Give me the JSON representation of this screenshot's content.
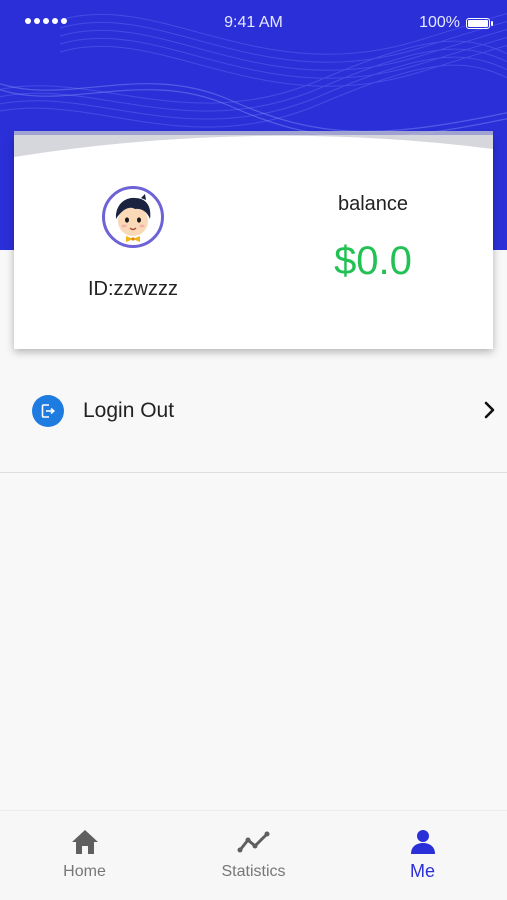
{
  "status_bar": {
    "time": "9:41 AM",
    "battery": "100%"
  },
  "profile": {
    "user_id": "ID:zzwzzz",
    "balance_label": "balance",
    "balance_value": "$0.0"
  },
  "menu": {
    "items": [
      {
        "label": "Login Out",
        "icon": "logout-icon"
      }
    ]
  },
  "tab_bar": {
    "tabs": [
      {
        "label": "Home",
        "icon": "home-icon",
        "active": false
      },
      {
        "label": "Statistics",
        "icon": "trend-line-icon",
        "active": false
      },
      {
        "label": "Me",
        "icon": "person-icon",
        "active": true
      }
    ]
  },
  "colors": {
    "header_blue": "#2b2fd8",
    "balance_green": "#22c154",
    "logout_icon_blue": "#1e7be0",
    "active_tab": "#2b2fd8",
    "inactive_tab": "#777777"
  }
}
